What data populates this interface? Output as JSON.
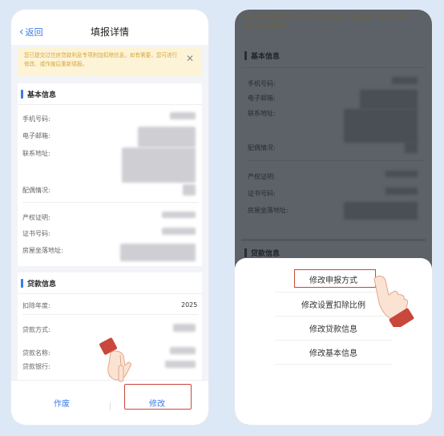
{
  "left_phone": {
    "header": {
      "back_label": "返回",
      "title": "填报详情"
    },
    "notice": {
      "text": "您已提交过住房贷款利息专项附加扣除信息，如有需要，您可进行修改、或作废后重新填报。"
    },
    "basic_info": {
      "title": "基本信息",
      "labels": [
        "手机号码:",
        "电子邮箱:",
        "联系地址:",
        "配偶情况:",
        "产权证明:",
        "证书号码:",
        "房屋坐落地址:"
      ]
    },
    "loan_info": {
      "title": "贷款信息",
      "deduction_year_label": "扣除年度:",
      "deduction_year_value": "2025",
      "labels": [
        "贷款方式:",
        "贷款名称:",
        "贷款银行:"
      ]
    },
    "bottom": {
      "void_label": "作废",
      "modify_label": "修改"
    }
  },
  "right_phone": {
    "notice_text": "您已提交过住房贷款利息专项附加扣除信息，如有需要，您可进行修改、或作废后重新填报。",
    "basic_info": {
      "title": "基本信息",
      "labels": [
        "手机号码:",
        "电子邮箱:",
        "联系地址:",
        "配偶情况:",
        "产权证明:",
        "证书号码:",
        "房屋坐落地址:"
      ]
    },
    "loan_info_title": "贷款信息",
    "sheet_options": [
      "修改申报方式",
      "修改设置扣除比例",
      "修改贷款信息",
      "修改基本信息"
    ]
  },
  "colors": {
    "accent": "#3b7be6",
    "highlight": "#c9473b",
    "notice_bg": "#fdf4d7",
    "notice_text": "#d8a43a"
  },
  "icons": [
    "chevron-left-icon",
    "close-icon",
    "pointing-hand-icon"
  ]
}
